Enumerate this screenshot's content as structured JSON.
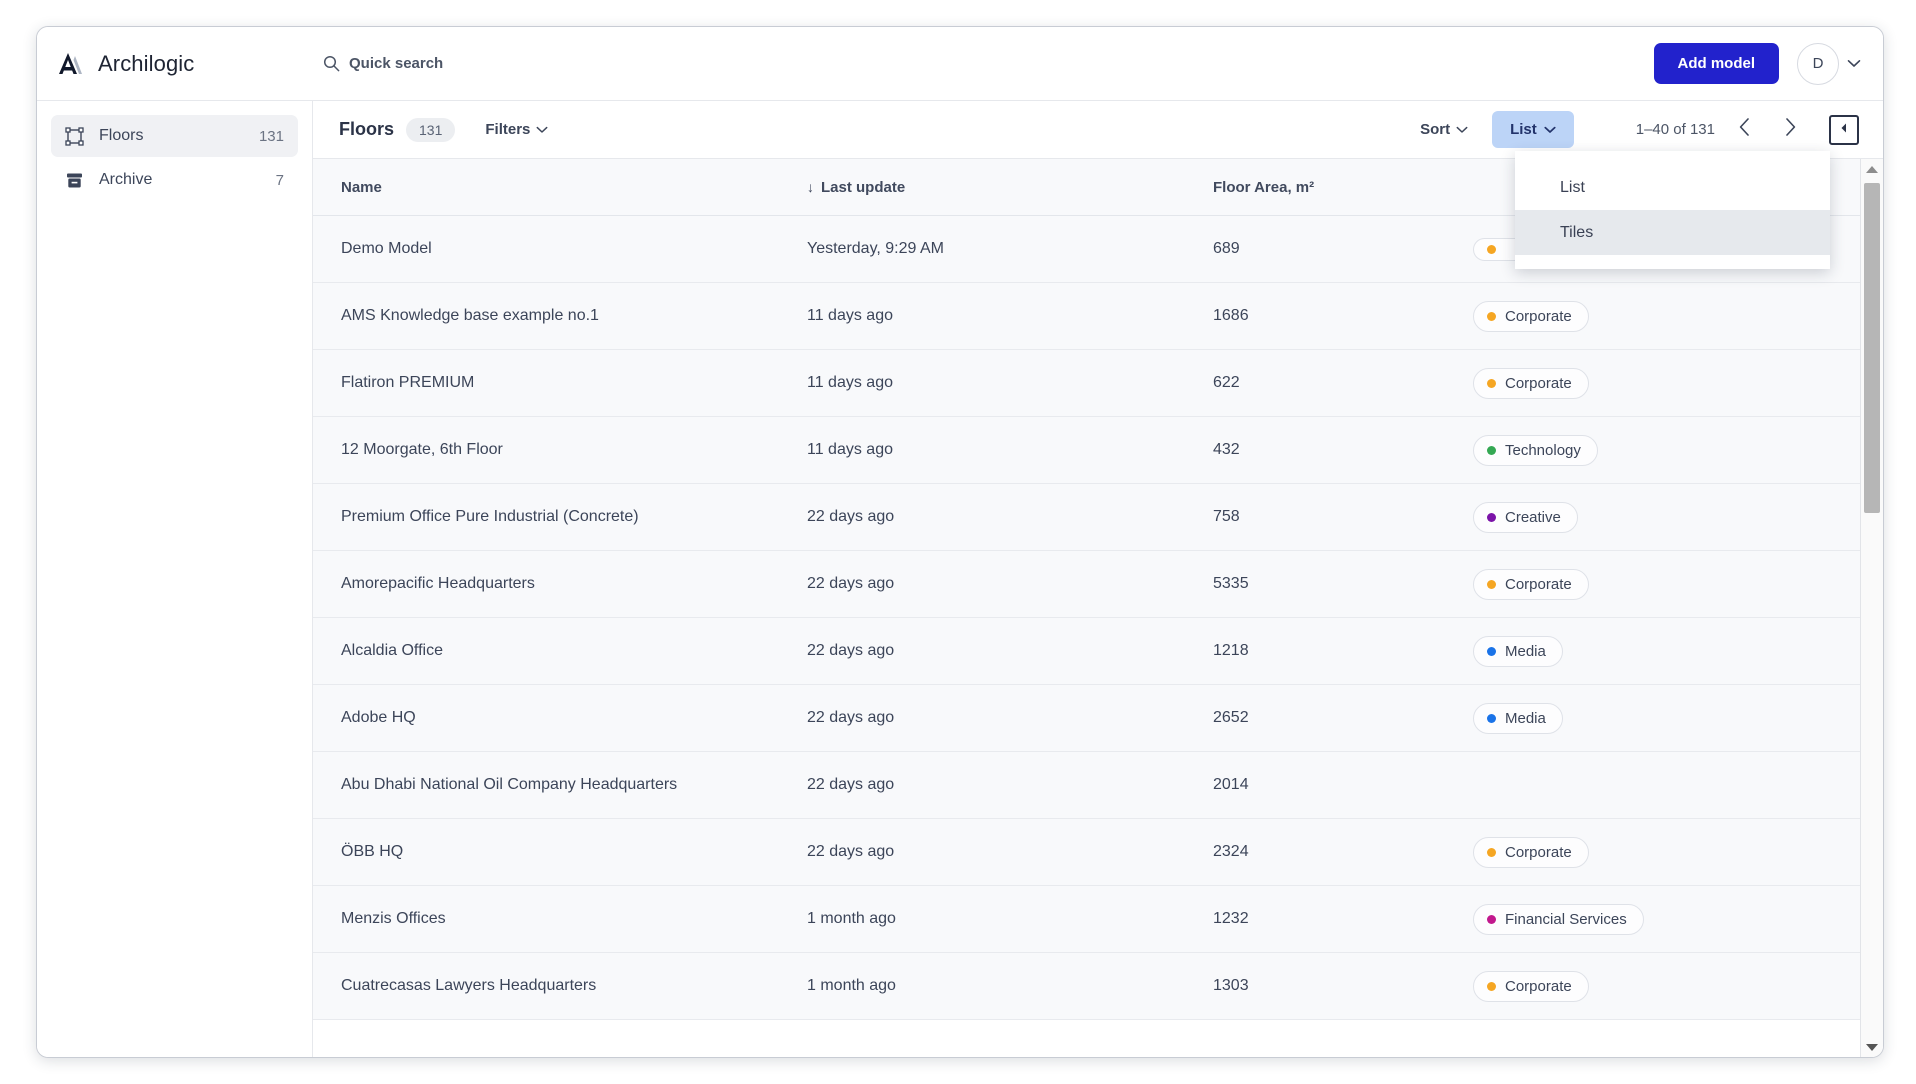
{
  "header": {
    "brand_name": "Archilogic",
    "brand_icon": "archilogic-logo-icon",
    "search_icon": "search-icon",
    "search_label": "Quick search",
    "add_model_label": "Add model",
    "avatar_initial": "D",
    "avatar_chevron_icon": "chevron-down-icon",
    "primary_color": "#2222cc"
  },
  "sidebar": {
    "items": [
      {
        "label": "Floors",
        "count": "131",
        "icon": "floorplan-icon",
        "active": true
      },
      {
        "label": "Archive",
        "count": "7",
        "icon": "archive-box-icon",
        "active": false
      }
    ]
  },
  "toolbar": {
    "title": "Floors",
    "count_pill": "131",
    "filters_label": "Filters",
    "filters_chevron_icon": "chevron-down-icon",
    "sort_label": "Sort",
    "sort_chevron_icon": "chevron-down-icon",
    "view_label": "List",
    "view_chevron_icon": "chevron-down-icon",
    "view_active_bg": "#bcd4f7",
    "range_label": "1–40 of 131",
    "prev_icon": "chevron-left-icon",
    "next_icon": "chevron-right-icon",
    "collapse_icon": "collapse-panel-icon"
  },
  "view_menu": {
    "open": true,
    "items": [
      {
        "label": "List",
        "hover": false
      },
      {
        "label": "Tiles",
        "hover": true
      }
    ]
  },
  "table": {
    "columns": [
      "Name",
      "Last update",
      "Floor Area, m²",
      ""
    ],
    "sort_column": "Last update",
    "sort_indicator": "↓",
    "rows": [
      {
        "name": "Demo Model",
        "last_update": "Yesterday, 9:29 AM",
        "area": "689",
        "tags": [
          {
            "label": "",
            "color": "#f5a623"
          },
          {
            "label": "",
            "color": "#f5a623"
          }
        ]
      },
      {
        "name": "AMS Knowledge base example no.1",
        "last_update": "11 days ago",
        "area": "1686",
        "tags": [
          {
            "label": "Corporate",
            "color": "#f5a623"
          }
        ]
      },
      {
        "name": "Flatiron PREMIUM",
        "last_update": "11 days ago",
        "area": "622",
        "tags": [
          {
            "label": "Corporate",
            "color": "#f5a623"
          }
        ]
      },
      {
        "name": "12 Moorgate, 6th Floor",
        "last_update": "11 days ago",
        "area": "432",
        "tags": [
          {
            "label": "Technology",
            "color": "#34a853"
          }
        ]
      },
      {
        "name": "Premium Office Pure Industrial (Concrete)",
        "last_update": "22 days ago",
        "area": "758",
        "tags": [
          {
            "label": "Creative",
            "color": "#7b13a8"
          }
        ]
      },
      {
        "name": "Amorepacific Headquarters",
        "last_update": "22 days ago",
        "area": "5335",
        "tags": [
          {
            "label": "Corporate",
            "color": "#f5a623"
          }
        ]
      },
      {
        "name": "Alcaldia Office",
        "last_update": "22 days ago",
        "area": "1218",
        "tags": [
          {
            "label": "Media",
            "color": "#1a73e8"
          }
        ]
      },
      {
        "name": "Adobe HQ",
        "last_update": "22 days ago",
        "area": "2652",
        "tags": [
          {
            "label": "Media",
            "color": "#1a73e8"
          }
        ]
      },
      {
        "name": "Abu Dhabi National Oil Company Headquarters",
        "last_update": "22 days ago",
        "area": "2014",
        "tags": []
      },
      {
        "name": "ÖBB HQ",
        "last_update": "22 days ago",
        "area": "2324",
        "tags": [
          {
            "label": "Corporate",
            "color": "#f5a623"
          }
        ]
      },
      {
        "name": "Menzis Offices",
        "last_update": "1 month ago",
        "area": "1232",
        "tags": [
          {
            "label": "Financial Services",
            "color": "#c2188d"
          }
        ]
      },
      {
        "name": "Cuatrecasas Lawyers Headquarters",
        "last_update": "1 month ago",
        "area": "1303",
        "tags": [
          {
            "label": "Corporate",
            "color": "#f5a623"
          }
        ]
      }
    ]
  },
  "scrollbar": {
    "up_icon": "scroll-up-arrow-icon",
    "down_icon": "scroll-down-arrow-icon"
  }
}
